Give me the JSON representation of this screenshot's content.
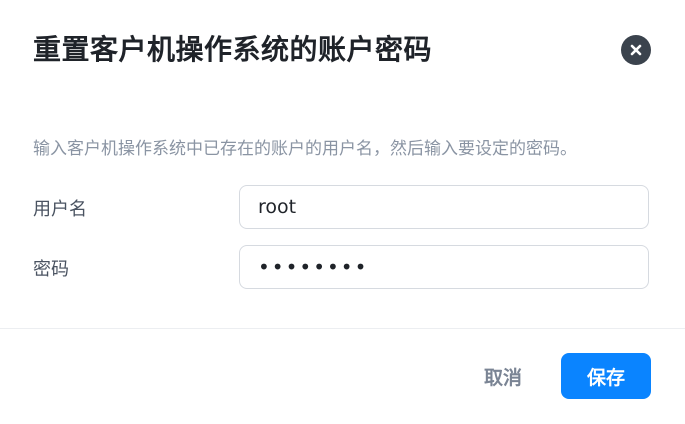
{
  "dialog": {
    "title": "重置客户机操作系统的账户密码",
    "close_icon": "close-icon",
    "description": "输入客户机操作系统中已存在的账户的用户名，然后输入要设定的密码。"
  },
  "form": {
    "username_label": "用户名",
    "username_value": "root",
    "password_label": "密码",
    "password_value": "••••••••"
  },
  "footer": {
    "cancel_label": "取消",
    "save_label": "保存"
  },
  "colors": {
    "primary": "#0a84ff",
    "close_bg": "#3b434d"
  }
}
